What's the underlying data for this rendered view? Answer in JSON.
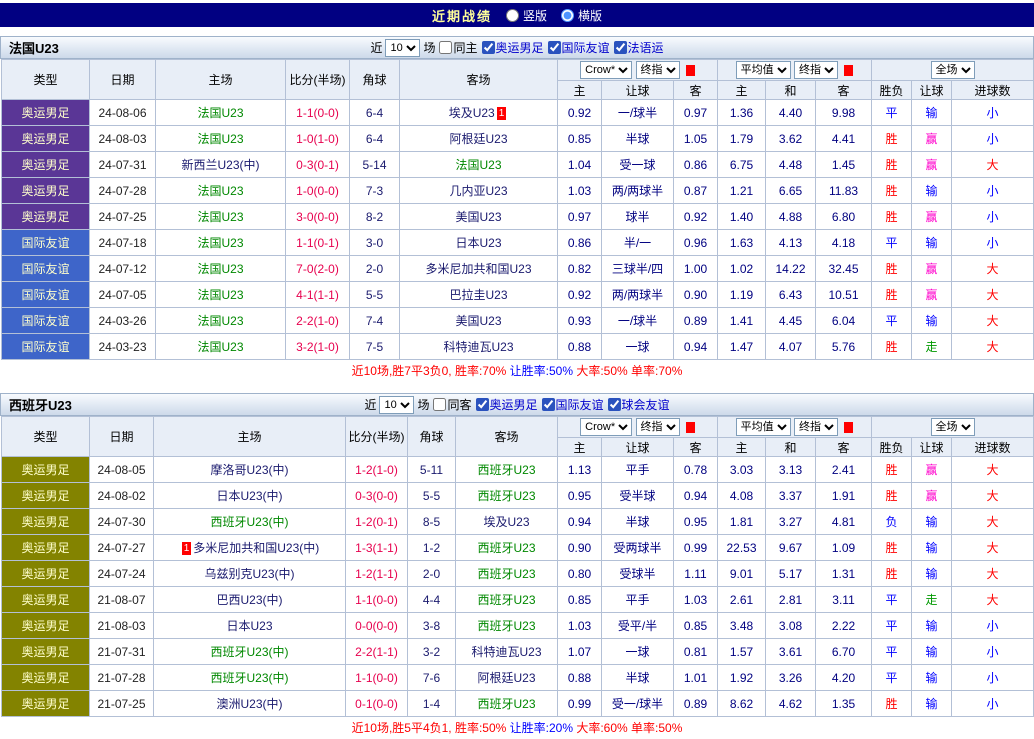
{
  "colors": {
    "topbar_navy": "#010082",
    "team_highlight_green": "#008800",
    "score_red": "#e7004e",
    "win_red": "#ff0000",
    "lose_blue": "#0000ff",
    "push_green": "#009900",
    "handicap_win_pink": "#ff00cc",
    "type_purple": "#5a3696",
    "type_blue": "#3e65c9",
    "type_olive": "#838300"
  },
  "topbar": {
    "title": "近期战绩",
    "options": [
      {
        "label": "竖版",
        "selected": false
      },
      {
        "label": "横版",
        "selected": true
      }
    ]
  },
  "table_columns": [
    "类型",
    "日期",
    "主场",
    "比分(半场)",
    "角球",
    "客场"
  ],
  "odds_header": {
    "book_select": "Crow*",
    "final_select": "终指",
    "avg_select": "平均值",
    "fulltime_select": "全场",
    "sub_cols": [
      "主",
      "让球",
      "客",
      "主",
      "和",
      "客",
      "胜负",
      "让球",
      "进球数"
    ]
  },
  "sections": [
    {
      "title": "法国U23",
      "filter": {
        "near_label": "近",
        "match_count": "10",
        "games_label": "场",
        "same_label": "同主",
        "same_checked": false,
        "comps": [
          {
            "label": "奥运男足",
            "checked": true
          },
          {
            "label": "国际友谊",
            "checked": true
          },
          {
            "label": "法语运",
            "checked": true
          }
        ]
      },
      "rows": [
        {
          "type": "奥运男足",
          "type_cls": "t-purple",
          "date": "24-08-06",
          "home": "法国U23",
          "home_hl": true,
          "score": "1-1(0-0)",
          "corner": "6-4",
          "away": "埃及U23",
          "away_hl": false,
          "away_badge": "1",
          "crow_home": "0.92",
          "handicap": "一/球半",
          "crow_away": "0.97",
          "avg_home": "1.36",
          "avg_draw": "4.40",
          "avg_away": "9.98",
          "result_wdl": "平",
          "result_handicap": "输",
          "result_ou": "小"
        },
        {
          "type": "奥运男足",
          "type_cls": "t-purple",
          "date": "24-08-03",
          "home": "法国U23",
          "home_hl": true,
          "score": "1-0(1-0)",
          "corner": "6-4",
          "away": "阿根廷U23",
          "away_hl": false,
          "crow_home": "0.85",
          "handicap": "半球",
          "crow_away": "1.05",
          "avg_home": "1.79",
          "avg_draw": "3.62",
          "avg_away": "4.41",
          "result_wdl": "胜",
          "result_handicap": "赢",
          "result_ou": "小"
        },
        {
          "type": "奥运男足",
          "type_cls": "t-purple",
          "date": "24-07-31",
          "home": "新西兰U23(中)",
          "home_hl": false,
          "score": "0-3(0-1)",
          "corner": "5-14",
          "away": "法国U23",
          "away_hl": true,
          "crow_home": "1.04",
          "handicap": "受一球",
          "crow_away": "0.86",
          "avg_home": "6.75",
          "avg_draw": "4.48",
          "avg_away": "1.45",
          "result_wdl": "胜",
          "result_handicap": "赢",
          "result_ou": "大"
        },
        {
          "type": "奥运男足",
          "type_cls": "t-purple",
          "date": "24-07-28",
          "home": "法国U23",
          "home_hl": true,
          "score": "1-0(0-0)",
          "corner": "7-3",
          "away": "几内亚U23",
          "away_hl": false,
          "crow_home": "1.03",
          "handicap": "两/两球半",
          "crow_away": "0.87",
          "avg_home": "1.21",
          "avg_draw": "6.65",
          "avg_away": "11.83",
          "result_wdl": "胜",
          "result_handicap": "输",
          "result_ou": "小"
        },
        {
          "type": "奥运男足",
          "type_cls": "t-purple",
          "date": "24-07-25",
          "home": "法国U23",
          "home_hl": true,
          "score": "3-0(0-0)",
          "corner": "8-2",
          "away": "美国U23",
          "away_hl": false,
          "crow_home": "0.97",
          "handicap": "球半",
          "crow_away": "0.92",
          "avg_home": "1.40",
          "avg_draw": "4.88",
          "avg_away": "6.80",
          "result_wdl": "胜",
          "result_handicap": "赢",
          "result_ou": "小"
        },
        {
          "type": "国际友谊",
          "type_cls": "t-blue",
          "date": "24-07-18",
          "home": "法国U23",
          "home_hl": true,
          "score": "1-1(0-1)",
          "corner": "3-0",
          "away": "日本U23",
          "away_hl": false,
          "crow_home": "0.86",
          "handicap": "半/一",
          "crow_away": "0.96",
          "avg_home": "1.63",
          "avg_draw": "4.13",
          "avg_away": "4.18",
          "result_wdl": "平",
          "result_handicap": "输",
          "result_ou": "小"
        },
        {
          "type": "国际友谊",
          "type_cls": "t-blue",
          "date": "24-07-12",
          "home": "法国U23",
          "home_hl": true,
          "score": "7-0(2-0)",
          "corner": "2-0",
          "away": "多米尼加共和国U23",
          "away_hl": false,
          "crow_home": "0.82",
          "handicap": "三球半/四",
          "crow_away": "1.00",
          "avg_home": "1.02",
          "avg_draw": "14.22",
          "avg_away": "32.45",
          "result_wdl": "胜",
          "result_handicap": "赢",
          "result_ou": "大"
        },
        {
          "type": "国际友谊",
          "type_cls": "t-blue",
          "date": "24-07-05",
          "home": "法国U23",
          "home_hl": true,
          "score": "4-1(1-1)",
          "corner": "5-5",
          "away": "巴拉圭U23",
          "away_hl": false,
          "crow_home": "0.92",
          "handicap": "两/两球半",
          "crow_away": "0.90",
          "avg_home": "1.19",
          "avg_draw": "6.43",
          "avg_away": "10.51",
          "result_wdl": "胜",
          "result_handicap": "赢",
          "result_ou": "大"
        },
        {
          "type": "国际友谊",
          "type_cls": "t-blue",
          "date": "24-03-26",
          "home": "法国U23",
          "home_hl": true,
          "score": "2-2(1-0)",
          "corner": "7-4",
          "away": "美国U23",
          "away_hl": false,
          "crow_home": "0.93",
          "handicap": "一/球半",
          "crow_away": "0.89",
          "avg_home": "1.41",
          "avg_draw": "4.45",
          "avg_away": "6.04",
          "result_wdl": "平",
          "result_handicap": "输",
          "result_ou": "大"
        },
        {
          "type": "国际友谊",
          "type_cls": "t-blue",
          "date": "24-03-23",
          "home": "法国U23",
          "home_hl": true,
          "score": "3-2(1-0)",
          "corner": "7-5",
          "away": "科特迪瓦U23",
          "away_hl": false,
          "crow_home": "0.88",
          "handicap": "一球",
          "crow_away": "0.94",
          "avg_home": "1.47",
          "avg_draw": "4.07",
          "avg_away": "5.76",
          "result_wdl": "胜",
          "result_handicap": "走",
          "result_ou": "大"
        }
      ],
      "summary": [
        {
          "text": "近10场,胜7平3负0, 胜率:70%",
          "color": "red"
        },
        {
          "text": " 让胜率:50%",
          "color": "blue"
        },
        {
          "text": " 大率:50%",
          "color": "red"
        },
        {
          "text": " 单率:70%",
          "color": "red"
        }
      ]
    },
    {
      "title": "西班牙U23",
      "filter": {
        "near_label": "近",
        "match_count": "10",
        "games_label": "场",
        "same_label": "同客",
        "same_checked": false,
        "comps": [
          {
            "label": "奥运男足",
            "checked": true
          },
          {
            "label": "国际友谊",
            "checked": true
          },
          {
            "label": "球会友谊",
            "checked": true
          }
        ]
      },
      "rows": [
        {
          "type": "奥运男足",
          "type_cls": "t-olive",
          "date": "24-08-05",
          "home": "摩洛哥U23(中)",
          "home_hl": false,
          "score": "1-2(1-0)",
          "corner": "5-11",
          "away": "西班牙U23",
          "away_hl": true,
          "crow_home": "1.13",
          "handicap": "平手",
          "crow_away": "0.78",
          "avg_home": "3.03",
          "avg_draw": "3.13",
          "avg_away": "2.41",
          "result_wdl": "胜",
          "result_handicap": "赢",
          "result_ou": "大"
        },
        {
          "type": "奥运男足",
          "type_cls": "t-olive",
          "date": "24-08-02",
          "home": "日本U23(中)",
          "home_hl": false,
          "score": "0-3(0-0)",
          "corner": "5-5",
          "away": "西班牙U23",
          "away_hl": true,
          "crow_home": "0.95",
          "handicap": "受半球",
          "crow_away": "0.94",
          "avg_home": "4.08",
          "avg_draw": "3.37",
          "avg_away": "1.91",
          "result_wdl": "胜",
          "result_handicap": "赢",
          "result_ou": "大"
        },
        {
          "type": "奥运男足",
          "type_cls": "t-olive",
          "date": "24-07-30",
          "home": "西班牙U23(中)",
          "home_hl": true,
          "score": "1-2(0-1)",
          "corner": "8-5",
          "away": "埃及U23",
          "away_hl": false,
          "crow_home": "0.94",
          "handicap": "半球",
          "crow_away": "0.95",
          "avg_home": "1.81",
          "avg_draw": "3.27",
          "avg_away": "4.81",
          "result_wdl": "负",
          "result_handicap": "输",
          "result_ou": "大"
        },
        {
          "type": "奥运男足",
          "type_cls": "t-olive",
          "date": "24-07-27",
          "home": "多米尼加共和国U23(中)",
          "home_hl": false,
          "home_badge": "1",
          "score": "1-3(1-1)",
          "corner": "1-2",
          "away": "西班牙U23",
          "away_hl": true,
          "crow_home": "0.90",
          "handicap": "受两球半",
          "crow_away": "0.99",
          "avg_home": "22.53",
          "avg_draw": "9.67",
          "avg_away": "1.09",
          "result_wdl": "胜",
          "result_handicap": "输",
          "result_ou": "大"
        },
        {
          "type": "奥运男足",
          "type_cls": "t-olive",
          "date": "24-07-24",
          "home": "乌兹别克U23(中)",
          "home_hl": false,
          "score": "1-2(1-1)",
          "corner": "2-0",
          "away": "西班牙U23",
          "away_hl": true,
          "crow_home": "0.80",
          "handicap": "受球半",
          "crow_away": "1.11",
          "avg_home": "9.01",
          "avg_draw": "5.17",
          "avg_away": "1.31",
          "result_wdl": "胜",
          "result_handicap": "输",
          "result_ou": "大"
        },
        {
          "type": "奥运男足",
          "type_cls": "t-olive",
          "date": "21-08-07",
          "home": "巴西U23(中)",
          "home_hl": false,
          "score": "1-1(0-0)",
          "corner": "4-4",
          "away": "西班牙U23",
          "away_hl": true,
          "crow_home": "0.85",
          "handicap": "平手",
          "crow_away": "1.03",
          "avg_home": "2.61",
          "avg_draw": "2.81",
          "avg_away": "3.11",
          "result_wdl": "平",
          "result_handicap": "走",
          "result_ou": "大"
        },
        {
          "type": "奥运男足",
          "type_cls": "t-olive",
          "date": "21-08-03",
          "home": "日本U23",
          "home_hl": false,
          "score": "0-0(0-0)",
          "corner": "3-8",
          "away": "西班牙U23",
          "away_hl": true,
          "crow_home": "1.03",
          "handicap": "受平/半",
          "crow_away": "0.85",
          "avg_home": "3.48",
          "avg_draw": "3.08",
          "avg_away": "2.22",
          "result_wdl": "平",
          "result_handicap": "输",
          "result_ou": "小"
        },
        {
          "type": "奥运男足",
          "type_cls": "t-olive",
          "date": "21-07-31",
          "home": "西班牙U23(中)",
          "home_hl": true,
          "score": "2-2(1-1)",
          "corner": "3-2",
          "away": "科特迪瓦U23",
          "away_hl": false,
          "crow_home": "1.07",
          "handicap": "一球",
          "crow_away": "0.81",
          "avg_home": "1.57",
          "avg_draw": "3.61",
          "avg_away": "6.70",
          "result_wdl": "平",
          "result_handicap": "输",
          "result_ou": "小"
        },
        {
          "type": "奥运男足",
          "type_cls": "t-olive",
          "date": "21-07-28",
          "home": "西班牙U23(中)",
          "home_hl": true,
          "score": "1-1(0-0)",
          "corner": "7-6",
          "away": "阿根廷U23",
          "away_hl": false,
          "crow_home": "0.88",
          "handicap": "半球",
          "crow_away": "1.01",
          "avg_home": "1.92",
          "avg_draw": "3.26",
          "avg_away": "4.20",
          "result_wdl": "平",
          "result_handicap": "输",
          "result_ou": "小"
        },
        {
          "type": "奥运男足",
          "type_cls": "t-olive",
          "date": "21-07-25",
          "home": "澳洲U23(中)",
          "home_hl": false,
          "score": "0-1(0-0)",
          "corner": "1-4",
          "away": "西班牙U23",
          "away_hl": true,
          "crow_home": "0.99",
          "handicap": "受一/球半",
          "crow_away": "0.89",
          "avg_home": "8.62",
          "avg_draw": "4.62",
          "avg_away": "1.35",
          "result_wdl": "胜",
          "result_handicap": "输",
          "result_ou": "小"
        }
      ],
      "summary": [
        {
          "text": "近10场,胜5平4负1, 胜率:50%",
          "color": "red"
        },
        {
          "text": " 让胜率:20%",
          "color": "blue"
        },
        {
          "text": " 大率:60%",
          "color": "red"
        },
        {
          "text": " 单率:50%",
          "color": "red"
        }
      ]
    }
  ]
}
